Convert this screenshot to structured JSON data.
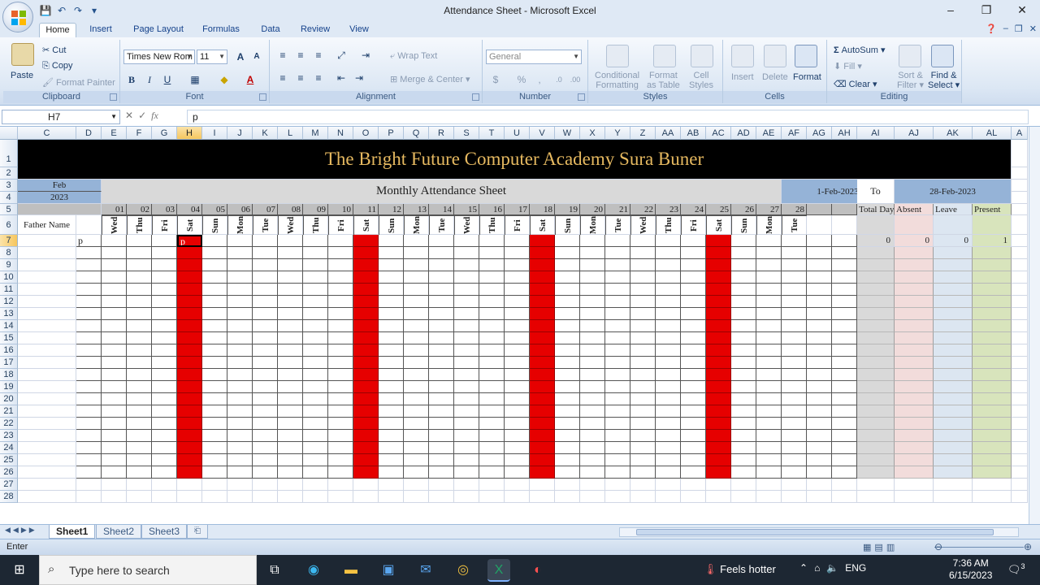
{
  "window": {
    "title": "Attendance Sheet - Microsoft Excel",
    "minimize": "–",
    "restore": "❐",
    "close": "✕"
  },
  "ribbon_tabs": [
    "Home",
    "Insert",
    "Page Layout",
    "Formulas",
    "Data",
    "Review",
    "View"
  ],
  "ribbon": {
    "clipboard": {
      "paste": "Paste",
      "cut": "Cut",
      "copy": "Copy",
      "format_painter": "Format Painter",
      "label": "Clipboard"
    },
    "font": {
      "family": "Times New Rom",
      "size": "11",
      "bold": "B",
      "italic": "I",
      "underline": "U",
      "label": "Font"
    },
    "alignment": {
      "wrap_text": "Wrap Text",
      "merge_center": "Merge & Center",
      "label": "Alignment"
    },
    "number": {
      "format": "General",
      "currency": "$",
      "percent": "%",
      "comma": ",",
      "label": "Number"
    },
    "styles": {
      "conditional": "Conditional",
      "formatting": "Formatting",
      "format_as": "Format",
      "as_table": "as Table",
      "cell": "Cell",
      "styles_word": "Styles",
      "label": "Styles"
    },
    "cells": {
      "insert": "Insert",
      "delete": "Delete",
      "format": "Format",
      "label": "Cells"
    },
    "editing": {
      "autosum": "AutoSum",
      "fill": "Fill",
      "clear": "Clear",
      "sort_filter_1": "Sort &",
      "sort_filter_2": "Filter",
      "find_select_1": "Find &",
      "find_select_2": "Select",
      "label": "Editing"
    }
  },
  "formula_bar": {
    "name_box": "H7",
    "content": "p",
    "cancel": "✕",
    "enter": "✓",
    "fx": "fx"
  },
  "columns": [
    "C",
    "D",
    "E",
    "F",
    "G",
    "H",
    "I",
    "J",
    "K",
    "L",
    "M",
    "N",
    "O",
    "P",
    "Q",
    "R",
    "S",
    "T",
    "U",
    "V",
    "W",
    "X",
    "Y",
    "Z",
    "AA",
    "AB",
    "AC",
    "AD",
    "AE",
    "AF",
    "AG",
    "AH",
    "AI",
    "AJ",
    "AK",
    "AL",
    "A"
  ],
  "rows": [
    "1",
    "2",
    "3",
    "4",
    "5",
    "6",
    "7",
    "8",
    "9",
    "10",
    "11",
    "12",
    "13",
    "14",
    "15",
    "16",
    "17",
    "18",
    "19",
    "20",
    "21",
    "22",
    "23",
    "24",
    "25",
    "26",
    "27",
    "28"
  ],
  "sheet": {
    "title": "The Bright Future Computer Academy Sura Buner",
    "month": "Feb",
    "year": "2023",
    "subtitle": "Monthly Attendance Sheet",
    "from_date": "1-Feb-2023",
    "to_label": "To",
    "to_date": "28-Feb-2023",
    "father_name": "Father Name",
    "day_numbers": [
      "01",
      "02",
      "03",
      "04",
      "05",
      "06",
      "07",
      "08",
      "09",
      "10",
      "11",
      "12",
      "13",
      "14",
      "15",
      "16",
      "17",
      "18",
      "19",
      "20",
      "21",
      "22",
      "23",
      "24",
      "25",
      "26",
      "27",
      "28"
    ],
    "day_names": [
      "Wed",
      "Thu",
      "Fri",
      "Sat",
      "Sun",
      "Mon",
      "Tue",
      "Wed",
      "Thu",
      "Fri",
      "Sat",
      "Sun",
      "Mon",
      "Tue",
      "Wed",
      "Thu",
      "Fri",
      "Sat",
      "Sun",
      "Mon",
      "Tue",
      "Wed",
      "Thu",
      "Fri",
      "Sat",
      "Sun",
      "Mon",
      "Tue"
    ],
    "summary_headers": [
      "Total Day",
      "Absent",
      "Leave",
      "Present"
    ],
    "row7_values": [
      "0",
      "0",
      "0",
      "1"
    ],
    "row7_d": "p",
    "row7_h": "p",
    "sunday_color": "#e60000",
    "header_blue": "#95b3d7"
  },
  "sheet_tabs": [
    "Sheet1",
    "Sheet2",
    "Sheet3"
  ],
  "status": "Enter",
  "taskbar": {
    "search": "Type here to search",
    "weather": "Feels hotter",
    "lang": "ENG",
    "time": "7:36 AM",
    "date": "6/15/2023",
    "notif": "3"
  }
}
